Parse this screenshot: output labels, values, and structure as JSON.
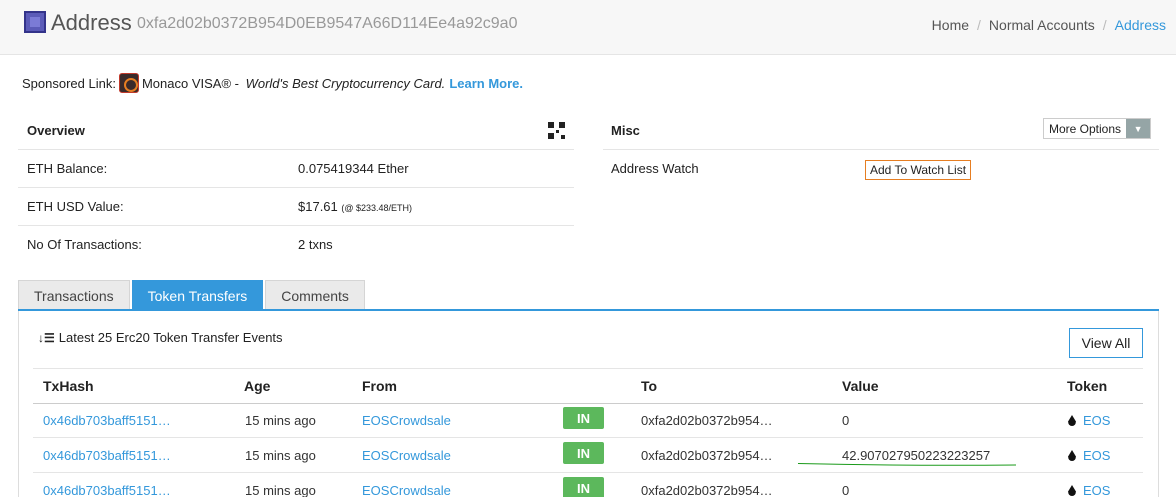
{
  "header": {
    "title": "Address",
    "address": "0xfa2d02b0372B954D0EB9547A66D114Ee4a92c9a0",
    "breadcrumb": [
      "Home",
      "Normal Accounts",
      "Address"
    ],
    "breadcrumb_sep": "/"
  },
  "sponsor": {
    "prefix": "Sponsored Link:",
    "name": "Monaco VISA®",
    "dash": " - ",
    "tagline": "World's Best Cryptocurrency Card.",
    "link": "Learn More."
  },
  "overview": {
    "title": "Overview",
    "rows": [
      {
        "label": "ETH Balance:",
        "value": "0.075419344 Ether"
      },
      {
        "label": "ETH USD Value:",
        "value": "$17.61",
        "extra": "(@ $233.48/ETH)"
      },
      {
        "label": "No Of Transactions:",
        "value": "2 txns"
      }
    ]
  },
  "misc": {
    "title": "Misc",
    "more_options": "More Options",
    "watch_label": "Address Watch",
    "watch_button": "Add To Watch List"
  },
  "tabs": [
    "Transactions",
    "Token Transfers",
    "Comments"
  ],
  "active_tab": "Token Transfers",
  "transfers": {
    "heading": "Latest 25 Erc20 Token Transfer Events",
    "view_all": "View All",
    "columns": [
      "TxHash",
      "Age",
      "From",
      "",
      "To",
      "Value",
      "Token"
    ],
    "rows": [
      {
        "hash": "0x46db703baff5151…",
        "age": "15 mins ago",
        "from": "EOSCrowdsale",
        "dir": "IN",
        "to": "0xfa2d02b0372b954…",
        "value": "0",
        "token": "EOS"
      },
      {
        "hash": "0x46db703baff5151…",
        "age": "15 mins ago",
        "from": "EOSCrowdsale",
        "dir": "IN",
        "to": "0xfa2d02b0372b954…",
        "value": "42.907027950223223257",
        "token": "EOS"
      },
      {
        "hash": "0x46db703baff5151…",
        "age": "15 mins ago",
        "from": "EOSCrowdsale",
        "dir": "IN",
        "to": "0xfa2d02b0372b954…",
        "value": "0",
        "token": "EOS"
      }
    ]
  },
  "colors": {
    "accent": "#3498db",
    "in_badge": "#5cb85c",
    "watch_border": "#e67e22",
    "annotation_underline": "#1a9a1a"
  },
  "icons": [
    "site-logo-icon",
    "monaco-logo-icon",
    "qr-code-icon",
    "chevron-down-icon",
    "sort-icon",
    "eos-token-icon"
  ]
}
